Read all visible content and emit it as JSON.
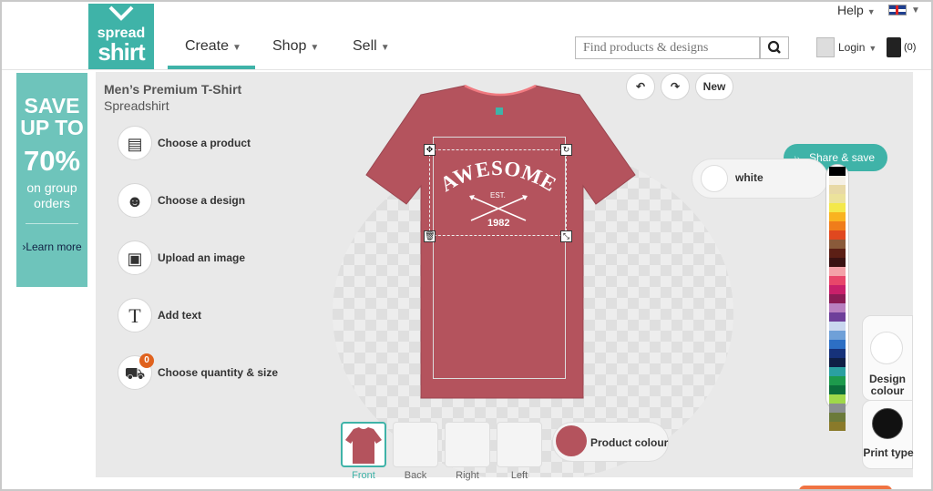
{
  "header": {
    "logo": {
      "line1": "spread",
      "line2": "shirt"
    },
    "nav": [
      {
        "label": "Create"
      },
      {
        "label": "Shop"
      },
      {
        "label": "Sell"
      }
    ],
    "help": "Help",
    "search_placeholder": "Find products & designs",
    "login": "Login",
    "cart": "(0)"
  },
  "promo": {
    "save": "SAVE UP TO",
    "percent": "70%",
    "group": "on group orders",
    "learn_more": "Learn more"
  },
  "product": {
    "title": "Men’s Premium T-Shirt",
    "brand": "Spreadshirt"
  },
  "menu": [
    {
      "label": "Choose a product",
      "icon": "tshirt-stack-icon"
    },
    {
      "label": "Choose a design",
      "icon": "smiley-icon"
    },
    {
      "label": "Upload an image",
      "icon": "upload-image-icon"
    },
    {
      "label": "Add text",
      "icon": "text-icon"
    },
    {
      "label": "Choose quantity & size",
      "icon": "size-shirts-icon"
    }
  ],
  "quantity_badge": "0",
  "toolbar": {
    "new": "New"
  },
  "design": {
    "main": "AWESOME",
    "est": "EST.",
    "year": "1982"
  },
  "share": "Share & save",
  "design_colour_name": "white",
  "palette": [
    "#000000",
    "#f5f0e6",
    "#e8d9a6",
    "#ece29b",
    "#f4e84a",
    "#f9b320",
    "#f07d1a",
    "#e0481f",
    "#8a5a3a",
    "#5c1f15",
    "#3a1212",
    "#f4a1a8",
    "#e8466a",
    "#c8206a",
    "#8a1c55",
    "#b87fc0",
    "#6e3f9a",
    "#c9d7ef",
    "#6fa0d8",
    "#2d6fc4",
    "#16327a",
    "#0f1f45",
    "#2aa0a0",
    "#1d9a4c",
    "#0b6e3b",
    "#9fd84a",
    "#8a8f90",
    "#6b7a3a",
    "#8a7a2a"
  ],
  "side": {
    "design_colour": "Design colour",
    "print_type": "Print type"
  },
  "views": [
    {
      "label": "Front"
    },
    {
      "label": "Back"
    },
    {
      "label": "Right"
    },
    {
      "label": "Left"
    }
  ],
  "product_colour": {
    "label": "Product colour",
    "hex": "#b4535d"
  }
}
